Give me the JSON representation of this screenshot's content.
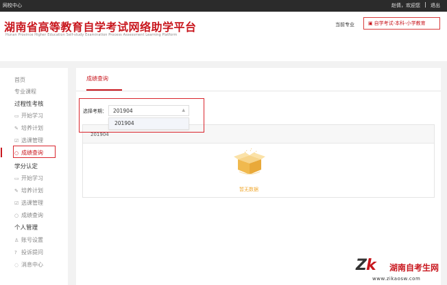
{
  "topbar": {
    "home": "网校中心",
    "greeting": "赵倩，欢迎您",
    "logout": "退出"
  },
  "header": {
    "title": "湖南省高等教育自学考试网络助学平台",
    "subtitle": "Hunan Province Higher Education Self-study Examination Process Assessment Learning Platform",
    "current_major_label": "当前专业",
    "major_button": "自学考试-本科-小学教育"
  },
  "sidebar": {
    "home": "首页",
    "courses": "专业课程",
    "process": {
      "title": "过程性考核",
      "items": [
        "开始学习",
        "培养计划",
        "选课管理",
        "成绩查询"
      ]
    },
    "credit": {
      "title": "学分认定",
      "items": [
        "开始学习",
        "培养计划",
        "选课管理",
        "成绩查询"
      ]
    },
    "personal": {
      "title": "个人管理",
      "items": [
        "账号设置",
        "投诉提问",
        "消息中心"
      ]
    }
  },
  "main": {
    "tab": "成绩查询",
    "select_label": "选择考期：",
    "select_value": "201904",
    "dropdown_option": "201904",
    "panel_header": "201904",
    "empty_text": "暂无数据"
  },
  "watermark": {
    "logo_z": "Z",
    "logo_k": "k",
    "name": "湖南自考生网",
    "url": "www.zikaosw.com"
  },
  "colors": {
    "accent": "#c8161d",
    "topbar": "#2b2b2b",
    "empty": "#f0a830"
  }
}
